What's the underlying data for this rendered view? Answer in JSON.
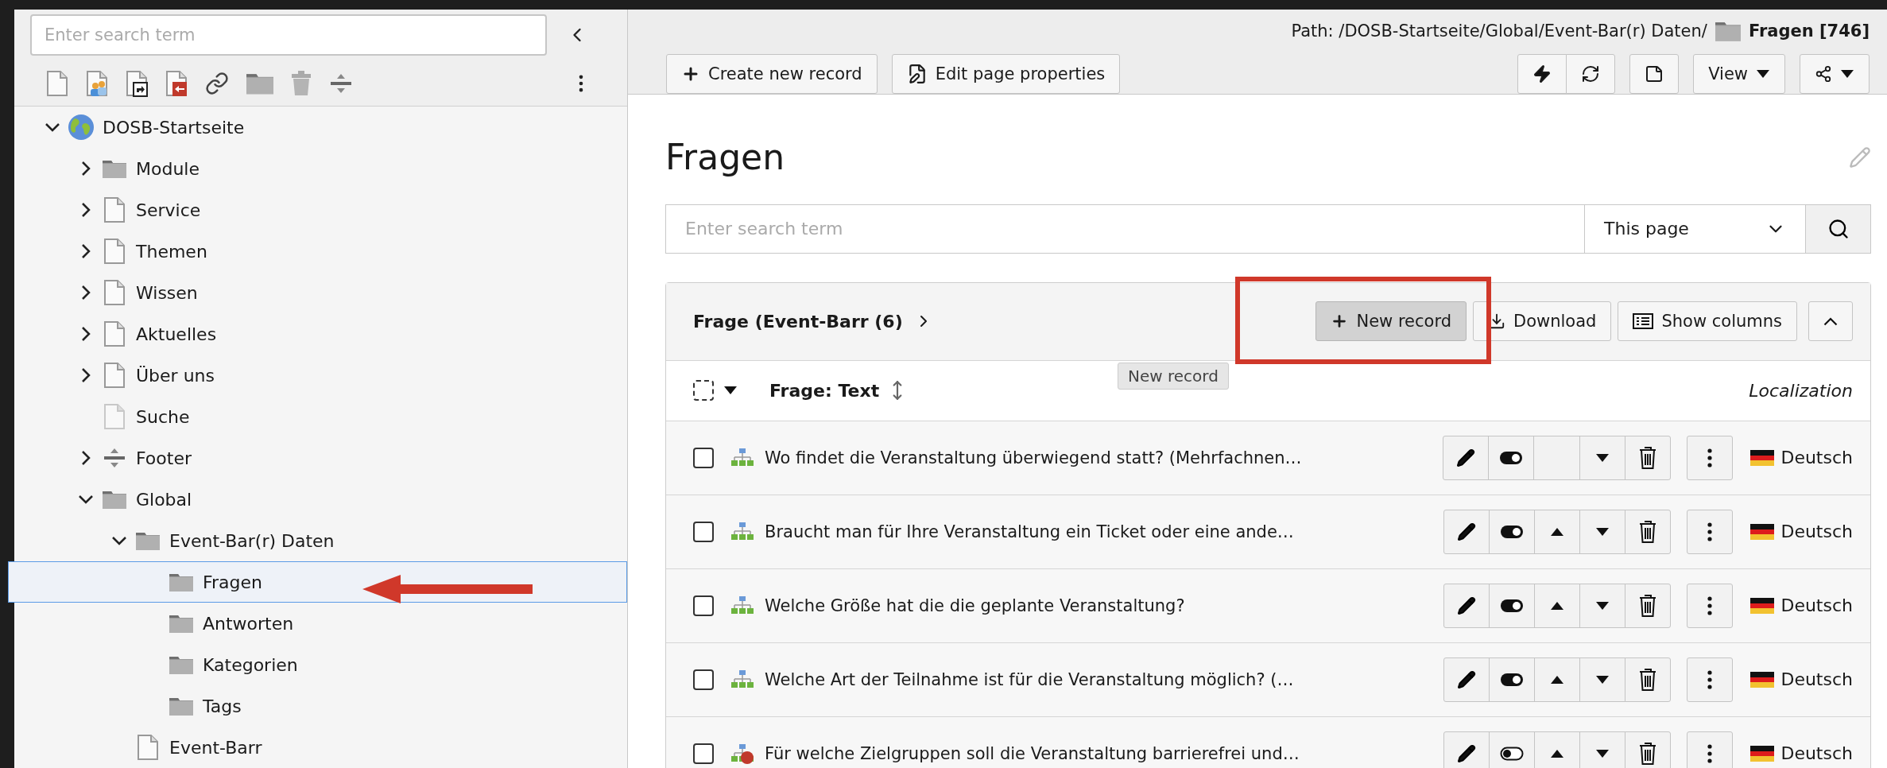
{
  "sidebar": {
    "search": {
      "placeholder": "Enter search term"
    },
    "tree": [
      {
        "label": "DOSB-Startseite",
        "kind": "globe",
        "expanded": true,
        "selected": false,
        "children": [
          {
            "label": "Module",
            "kind": "folder",
            "expanded": false,
            "selected": false
          },
          {
            "label": "Service",
            "kind": "page",
            "expanded": false,
            "selected": false
          },
          {
            "label": "Themen",
            "kind": "page",
            "expanded": false,
            "selected": false
          },
          {
            "label": "Wissen",
            "kind": "page",
            "expanded": false,
            "selected": false
          },
          {
            "label": "Aktuelles",
            "kind": "page",
            "expanded": false,
            "selected": false
          },
          {
            "label": "Über uns",
            "kind": "page",
            "expanded": false,
            "selected": false
          },
          {
            "label": "Suche",
            "kind": "page-faded",
            "selected": false
          },
          {
            "label": "Footer",
            "kind": "separator",
            "expanded": false,
            "selected": false
          },
          {
            "label": "Global",
            "kind": "folder",
            "expanded": true,
            "selected": false,
            "children": [
              {
                "label": "Event-Bar(r) Daten",
                "kind": "folder",
                "expanded": true,
                "selected": false,
                "children": [
                  {
                    "label": "Fragen",
                    "kind": "folder",
                    "selected": true
                  },
                  {
                    "label": "Antworten",
                    "kind": "folder",
                    "selected": false
                  },
                  {
                    "label": "Kategorien",
                    "kind": "folder",
                    "selected": false
                  },
                  {
                    "label": "Tags",
                    "kind": "folder",
                    "selected": false
                  }
                ]
              },
              {
                "label": "Event-Barr",
                "kind": "page",
                "selected": false
              }
            ]
          }
        ]
      }
    ]
  },
  "header": {
    "path": "Path: /DOSB-Startseite/Global/Event-Bar(r) Daten/",
    "current_page": "Fragen [746]",
    "buttons": [
      "Create new record",
      "Edit page properties"
    ],
    "view_button": "View"
  },
  "title": "Fragen",
  "search": {
    "placeholder": "Enter search term",
    "scope": "This page"
  },
  "list": {
    "title": "Frage (Event-Barr (6)",
    "buttons": [
      "New record",
      "Download",
      "Show columns"
    ],
    "tooltip": "New record",
    "select_all": {
      "checked": false
    },
    "column": "Frage: Text",
    "localization_column": "Localization",
    "rows": [
      {
        "checked": false,
        "text": "Wo findet die Veranstaltung überwiegend statt? (Mehrfachnen…",
        "hidden": false,
        "can_move_up": false,
        "language": "Deutsch"
      },
      {
        "checked": false,
        "text": "Braucht man für Ihre Veranstaltung ein Ticket oder eine ande…",
        "hidden": false,
        "can_move_up": true,
        "language": "Deutsch"
      },
      {
        "checked": false,
        "text": "Welche Größe hat die die geplante Veranstaltung?",
        "hidden": false,
        "can_move_up": true,
        "language": "Deutsch"
      },
      {
        "checked": false,
        "text": "Welche Art der Teilnahme ist für die Veranstaltung möglich? (…",
        "hidden": false,
        "can_move_up": true,
        "language": "Deutsch"
      },
      {
        "checked": false,
        "text": "Für welche Zielgruppen soll die Veranstaltung barrierefrei und…",
        "hidden": true,
        "can_move_up": true,
        "language": "Deutsch"
      }
    ]
  }
}
